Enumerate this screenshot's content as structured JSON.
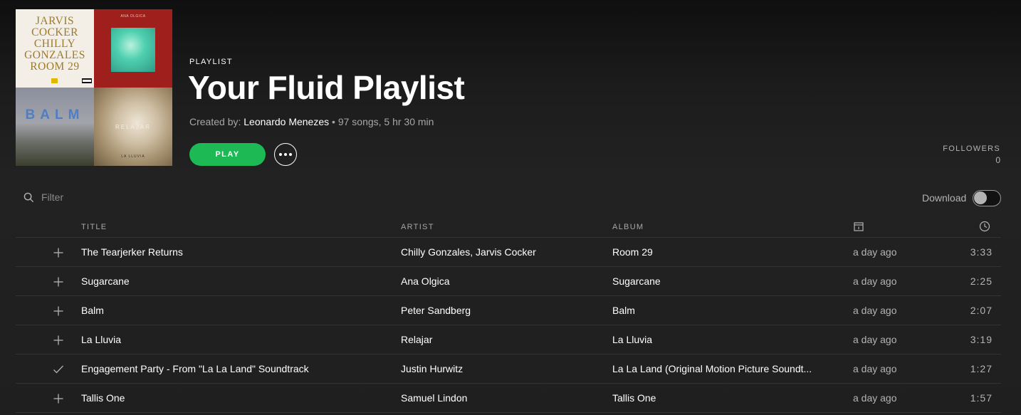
{
  "playlist": {
    "kind": "PLAYLIST",
    "title": "Your Fluid Playlist",
    "created_by_label": "Created by:",
    "owner": "Leonardo Menezes",
    "stats": " • 97 songs, 5 hr 30 min",
    "play_label": "PLAY",
    "followers_label": "FOLLOWERS",
    "followers_count": "0"
  },
  "cover": {
    "tile1_text": "JARVIS COCKER CHILLY GONZALES ROOM 29",
    "tile2_text": "ANA OLGICA",
    "tile3_text": "BALM",
    "tile4_text": "RELAJAR",
    "tile4_sub": "LA LLUVIA"
  },
  "filter": {
    "placeholder": "Filter"
  },
  "download": {
    "label": "Download",
    "enabled": false
  },
  "table": {
    "headers": {
      "title": "TITLE",
      "artist": "ARTIST",
      "album": "ALBUM"
    },
    "rows": [
      {
        "icon": "plus-icon",
        "title": "The Tearjerker Returns",
        "artist": "Chilly Gonzales, Jarvis Cocker",
        "album": "Room 29",
        "added": "a day ago",
        "duration": "3:33"
      },
      {
        "icon": "plus-icon",
        "title": "Sugarcane",
        "artist": "Ana Olgica",
        "album": "Sugarcane",
        "added": "a day ago",
        "duration": "2:25"
      },
      {
        "icon": "plus-icon",
        "title": "Balm",
        "artist": "Peter Sandberg",
        "album": "Balm",
        "added": "a day ago",
        "duration": "2:07"
      },
      {
        "icon": "plus-icon",
        "title": "La Lluvia",
        "artist": "Relajar",
        "album": "La Lluvia",
        "added": "a day ago",
        "duration": "3:19"
      },
      {
        "icon": "check-icon",
        "title": "Engagement Party - From \"La La Land\" Soundtrack",
        "artist": "Justin Hurwitz",
        "album": "La La Land (Original Motion Picture Soundt...",
        "added": "a day ago",
        "duration": "1:27"
      },
      {
        "icon": "plus-icon",
        "title": "Tallis One",
        "artist": "Samuel Lindon",
        "album": "Tallis One",
        "added": "a day ago",
        "duration": "1:57"
      }
    ]
  },
  "colors": {
    "accent": "#1db954",
    "background": "#181818",
    "muted_text": "#b3b3b3"
  }
}
